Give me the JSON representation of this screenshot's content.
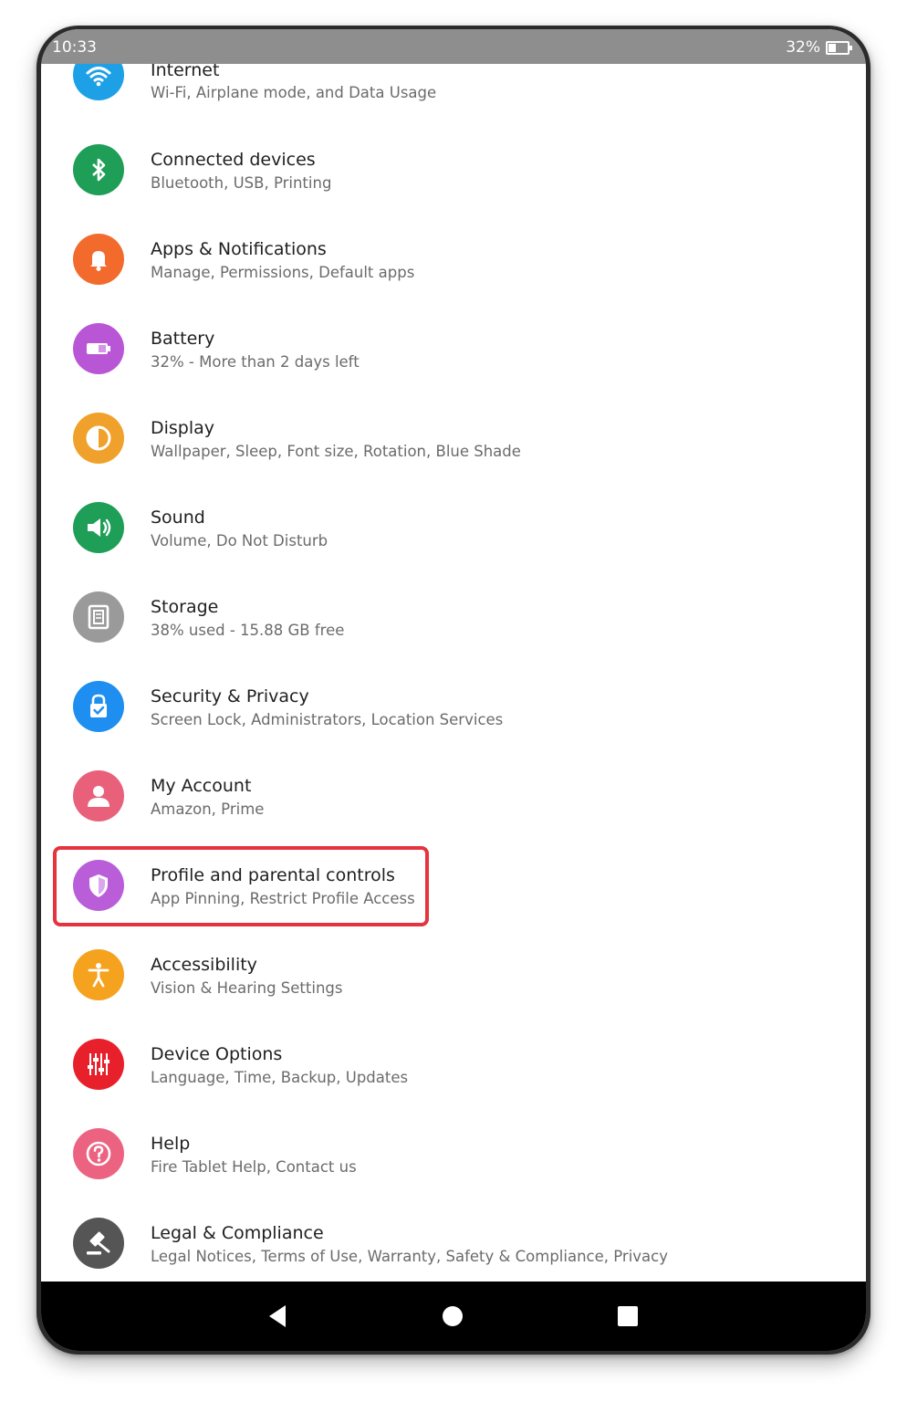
{
  "status_bar": {
    "time": "10:33",
    "battery_percent": "32%"
  },
  "items": [
    {
      "key": "internet",
      "title": "Internet",
      "subtitle": "Wi-Fi, Airplane mode, and Data Usage",
      "icon": "wifi-icon",
      "color": "#1ea0e6"
    },
    {
      "key": "connected-devices",
      "title": "Connected devices",
      "subtitle": "Bluetooth, USB, Printing",
      "icon": "bluetooth-icon",
      "color": "#1e9e57"
    },
    {
      "key": "apps-notifications",
      "title": "Apps & Notifications",
      "subtitle": "Manage, Permissions, Default apps",
      "icon": "bell-icon",
      "color": "#f26a2c"
    },
    {
      "key": "battery",
      "title": "Battery",
      "subtitle": "32% - More than 2 days left",
      "icon": "battery-icon",
      "color": "#b956d6"
    },
    {
      "key": "display",
      "title": "Display",
      "subtitle": "Wallpaper, Sleep, Font size, Rotation, Blue Shade",
      "icon": "brightness-icon",
      "color": "#f0a12b"
    },
    {
      "key": "sound",
      "title": "Sound",
      "subtitle": "Volume, Do Not Disturb",
      "icon": "speaker-icon",
      "color": "#1e9e57"
    },
    {
      "key": "storage",
      "title": "Storage",
      "subtitle": "38% used - 15.88 GB free",
      "icon": "storage-icon",
      "color": "#9a9a9a"
    },
    {
      "key": "security-privacy",
      "title": "Security & Privacy",
      "subtitle": "Screen Lock, Administrators, Location Services",
      "icon": "lock-icon",
      "color": "#1e8ff0"
    },
    {
      "key": "my-account",
      "title": "My Account",
      "subtitle": "Amazon, Prime",
      "icon": "person-icon",
      "color": "#e9607a"
    },
    {
      "key": "profile-parental",
      "title": "Profile and parental controls",
      "subtitle": "App Pinning, Restrict Profile Access",
      "icon": "shield-icon",
      "color": "#b95ed8"
    },
    {
      "key": "accessibility",
      "title": "Accessibility",
      "subtitle": "Vision & Hearing Settings",
      "icon": "accessibility-icon",
      "color": "#f5a21f"
    },
    {
      "key": "device-options",
      "title": "Device Options",
      "subtitle": "Language, Time, Backup, Updates",
      "icon": "sliders-icon",
      "color": "#e8202b"
    },
    {
      "key": "help",
      "title": "Help",
      "subtitle": "Fire Tablet Help, Contact us",
      "icon": "help-icon",
      "color": "#ec6382"
    },
    {
      "key": "legal-compliance",
      "title": "Legal & Compliance",
      "subtitle": "Legal Notices, Terms of Use, Warranty, Safety & Compliance, Privacy",
      "icon": "gavel-icon",
      "color": "#555555"
    }
  ],
  "highlight_color": "#e5333f"
}
